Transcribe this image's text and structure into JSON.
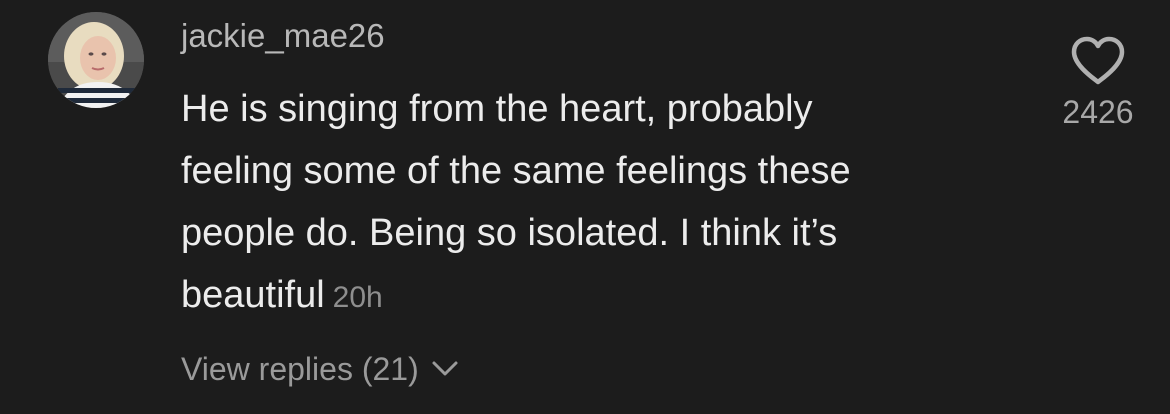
{
  "comment": {
    "username": "jackie_mae26",
    "text_lines": [
      "He is singing from the heart, probably",
      "feeling some of the same feelings these",
      "people do. Being so isolated. I think it’s",
      "beautiful"
    ],
    "timestamp": "20h",
    "view_replies_label": "View replies (21)",
    "like_count": "2426"
  },
  "icons": {
    "like": "heart-outline-icon",
    "expand": "chevron-down-icon",
    "avatar": "user-avatar"
  },
  "colors": {
    "background": "#1c1c1c",
    "username": "#b8b8b8",
    "text": "#ececec",
    "muted": "#8e8e8e"
  }
}
